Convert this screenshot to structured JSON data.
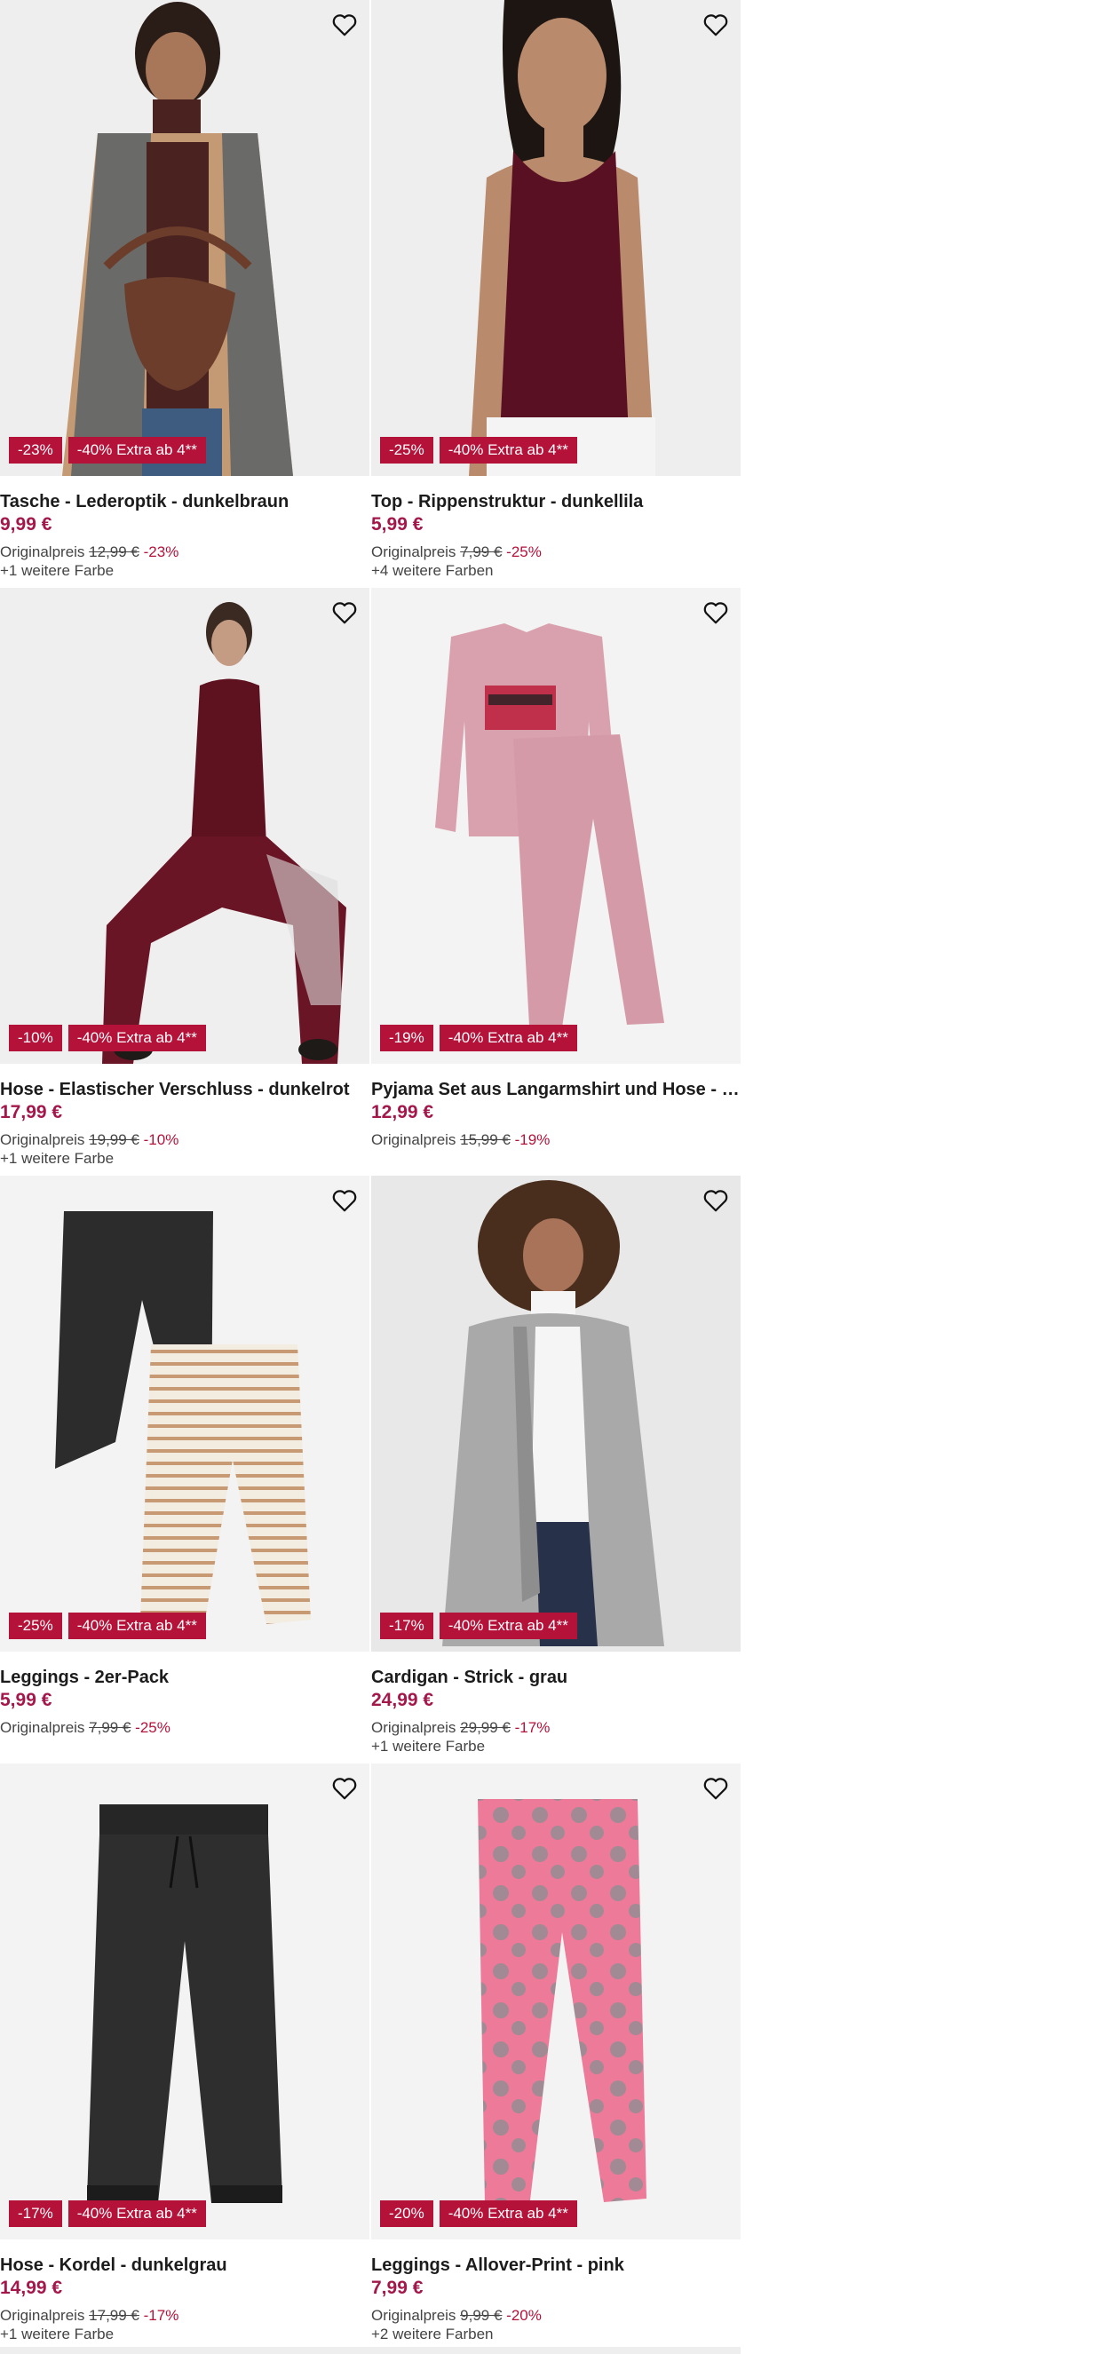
{
  "products": [
    {
      "title": "Tasche - Lederoptik - dunkelbraun",
      "price": "9,99 €",
      "orig_label": "Originalpreis",
      "orig_price": "12,99 €",
      "orig_discount": "-23%",
      "colors": "+1 weitere Farbe",
      "badge_discount": "-23%",
      "badge_extra": "-40% Extra ab 4**",
      "image_icon": "bag-model-image"
    },
    {
      "title": "Top - Rippenstruktur - dunkellila",
      "price": "5,99 €",
      "orig_label": "Originalpreis",
      "orig_price": "7,99 €",
      "orig_discount": "-25%",
      "colors": "+4 weitere Farben",
      "badge_discount": "-25%",
      "badge_extra": "-40% Extra ab 4**",
      "image_icon": "top-model-image"
    },
    {
      "title": "Hose - Elastischer Verschluss - dunkelrot",
      "price": "17,99 €",
      "orig_label": "Originalpreis",
      "orig_price": "19,99 €",
      "orig_discount": "-10%",
      "colors": "+1 weitere Farbe",
      "badge_discount": "-10%",
      "badge_extra": "-40% Extra ab 4**",
      "image_icon": "trousers-model-image"
    },
    {
      "title": "Pyjama Set aus Langarmshirt und Hose - Prin...",
      "price": "12,99 €",
      "orig_label": "Originalpreis",
      "orig_price": "15,99 €",
      "orig_discount": "-19%",
      "colors": "",
      "badge_discount": "-19%",
      "badge_extra": "-40% Extra ab 4**",
      "image_icon": "pyjama-set-image"
    },
    {
      "title": "Leggings - 2er-Pack",
      "price": "5,99 €",
      "orig_label": "Originalpreis",
      "orig_price": "7,99 €",
      "orig_discount": "-25%",
      "colors": "",
      "badge_discount": "-25%",
      "badge_extra": "-40% Extra ab 4**",
      "image_icon": "leggings-pack-image"
    },
    {
      "title": "Cardigan - Strick - grau",
      "price": "24,99 €",
      "orig_label": "Originalpreis",
      "orig_price": "29,99 €",
      "orig_discount": "-17%",
      "colors": "+1 weitere Farbe",
      "badge_discount": "-17%",
      "badge_extra": "-40% Extra ab 4**",
      "image_icon": "cardigan-model-image"
    },
    {
      "title": "Hose - Kordel - dunkelgrau",
      "price": "14,99 €",
      "orig_label": "Originalpreis",
      "orig_price": "17,99 €",
      "orig_discount": "-17%",
      "colors": "+1 weitere Farbe",
      "badge_discount": "-17%",
      "badge_extra": "-40% Extra ab 4**",
      "image_icon": "jogger-pants-image"
    },
    {
      "title": "Leggings - Allover-Print - pink",
      "price": "7,99 €",
      "orig_label": "Originalpreis",
      "orig_price": "9,99 €",
      "orig_discount": "-20%",
      "colors": "+2 weitere Farben",
      "badge_discount": "-20%",
      "badge_extra": "-40% Extra ab 4**",
      "image_icon": "pink-leggings-image"
    }
  ],
  "colors": {
    "badge_bg": "#b5123a",
    "price": "#a3174b",
    "image_bg": "#efefef"
  }
}
